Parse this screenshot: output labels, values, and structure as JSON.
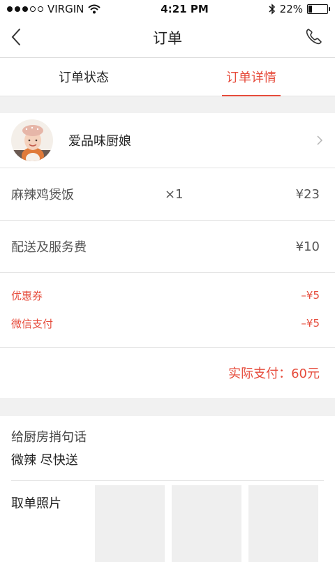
{
  "status_bar": {
    "carrier": "VIRGIN",
    "time": "4:21 PM",
    "battery": "22%",
    "battery_level": 0.22,
    "icons": [
      "signal-dots-icon",
      "wifi-icon",
      "bluetooth-icon",
      "battery-icon"
    ]
  },
  "nav": {
    "title": "订单",
    "back_icon": "back-chevron-icon",
    "phone_icon": "phone-icon"
  },
  "tabs": [
    {
      "label": "订单状态",
      "active": false
    },
    {
      "label": "订单详情",
      "active": true
    }
  ],
  "chef": {
    "name": "爱品味厨娘",
    "avatar_icon": "chef-avatar"
  },
  "items": [
    {
      "name": "麻辣鸡煲饭",
      "qty": "×1",
      "price": "¥23"
    }
  ],
  "fees": {
    "label": "配送及服务费",
    "price": "¥10"
  },
  "discounts": [
    {
      "label": "优惠券",
      "amount": "–¥5"
    },
    {
      "label": "微信支付",
      "amount": "–¥5"
    }
  ],
  "total": {
    "label": "实际支付：60元"
  },
  "note": {
    "label": "给厨房捎句话",
    "text": "微辣 尽快送"
  },
  "photos": {
    "label": "取单照片",
    "slots": 3
  },
  "colors": {
    "accent": "#e64b3b",
    "divider": "#e3e3e3",
    "section_gap": "#f1f1f1"
  }
}
